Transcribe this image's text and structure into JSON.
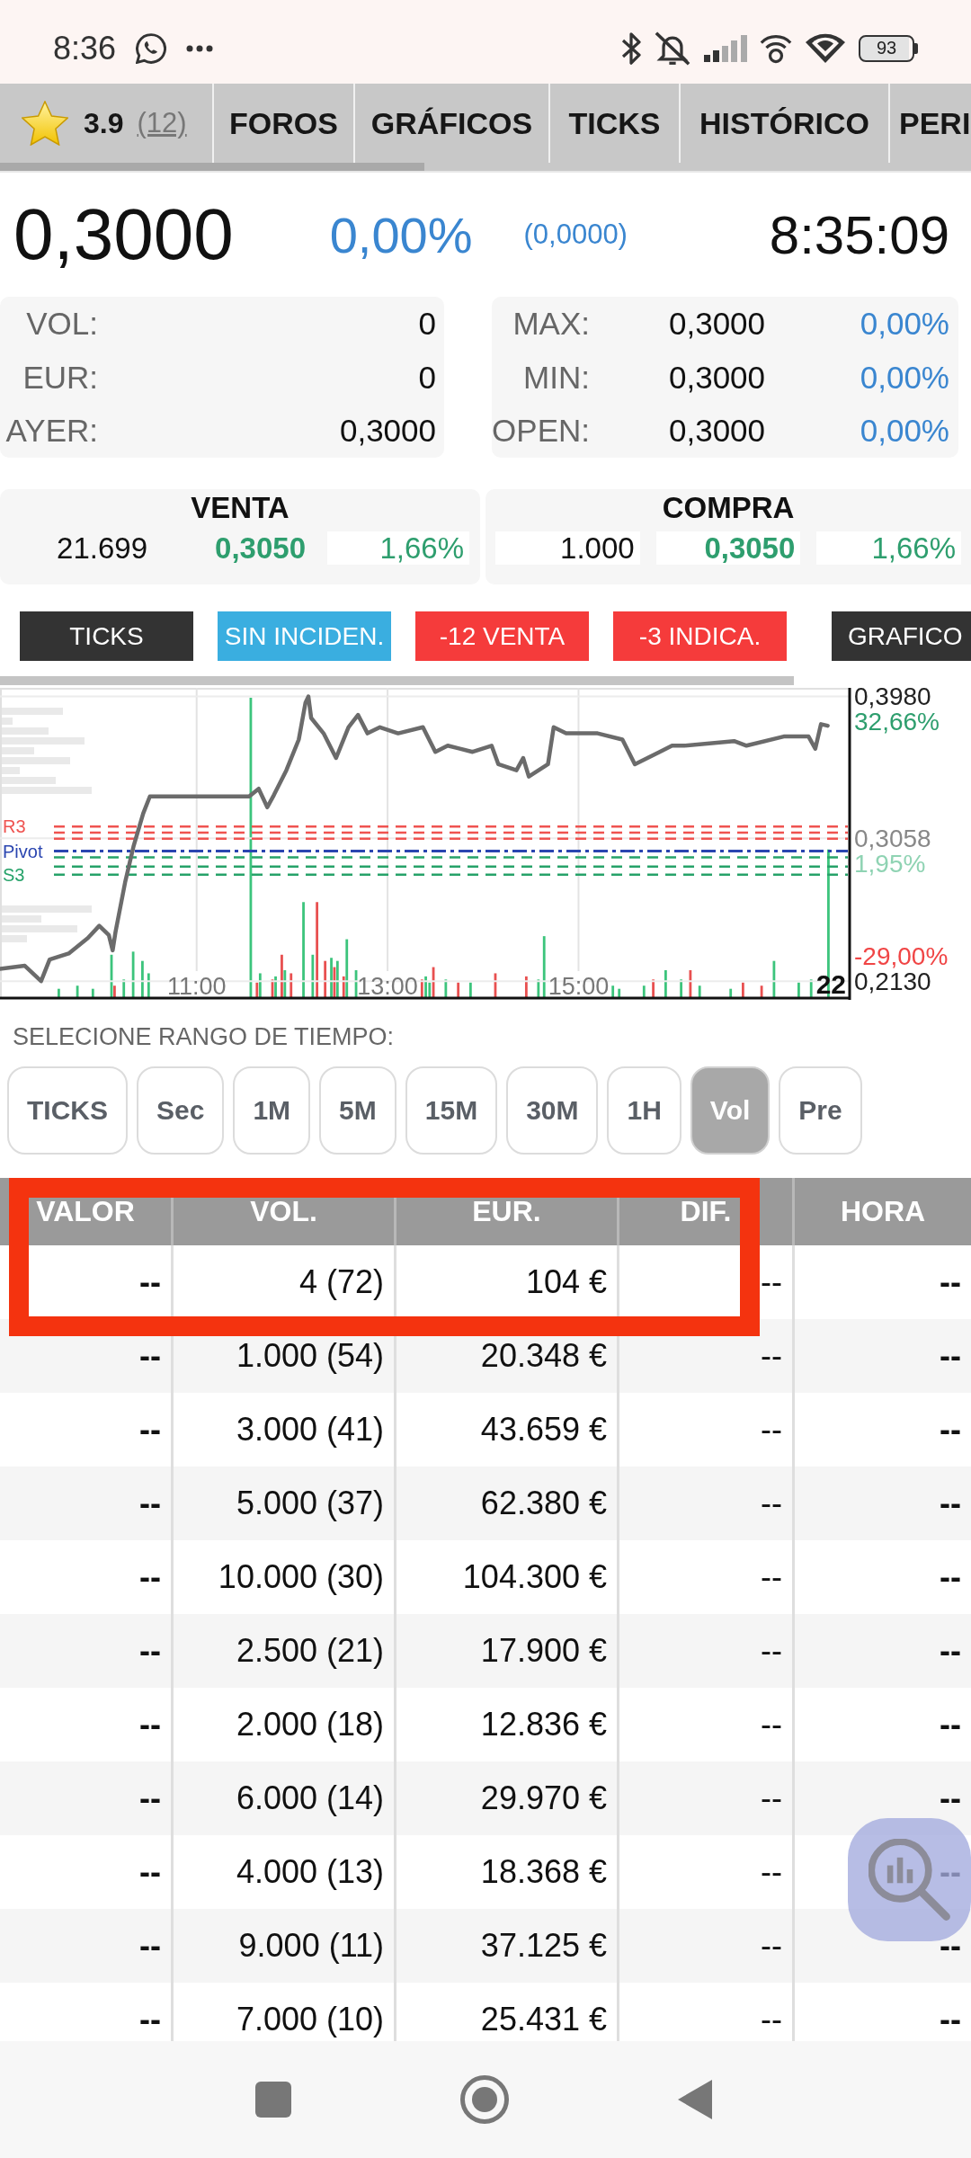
{
  "status_bar": {
    "time": "8:36",
    "battery": "93"
  },
  "tabs": {
    "rating": {
      "score": "3.9",
      "count": "(12)"
    },
    "items": [
      {
        "label": "FOROS",
        "selected": false
      },
      {
        "label": "GRÁFICOS",
        "selected": false
      },
      {
        "label": "TICKS",
        "selected": false
      },
      {
        "label": "HISTÓRICO",
        "selected": false
      },
      {
        "label": "PERI",
        "selected": false
      }
    ]
  },
  "quote": {
    "price": "0,3000",
    "change_percent": "0,00%",
    "change": "(0,0000)",
    "time": "8:35:09"
  },
  "stats": {
    "left": [
      {
        "label": "VOL:",
        "value": "0"
      },
      {
        "label": "EUR:",
        "value": "0"
      },
      {
        "label": "AYER:",
        "value": "0,3000"
      }
    ],
    "right": [
      {
        "label": "MAX:",
        "value": "0,3000",
        "change": "0,00%"
      },
      {
        "label": "MIN:",
        "value": "0,3000",
        "change": "0,00%"
      },
      {
        "label": "OPEN:",
        "value": "0,3000",
        "change": "0,00%"
      }
    ]
  },
  "order_book": [
    {
      "title": "VENTA",
      "cells": [
        {
          "kind": "quantity",
          "text": "21.699",
          "boxed": false
        },
        {
          "kind": "price",
          "text": "0,3050",
          "boxed": false
        },
        {
          "kind": "change",
          "text": "1,66%",
          "boxed": true
        }
      ]
    },
    {
      "title": "COMPRA",
      "cells": [
        {
          "kind": "quantity",
          "text": "1.000",
          "boxed": true
        },
        {
          "kind": "price",
          "text": "0,3050",
          "boxed": true
        },
        {
          "kind": "change",
          "text": "1,66%",
          "boxed": true
        }
      ]
    }
  ],
  "indicators": [
    {
      "label": "TICKS",
      "color": "#333333"
    },
    {
      "label": "SIN INCIDEN.",
      "color": "#3aaee0"
    },
    {
      "label": "-12 VENTA",
      "color": "#f53b3b"
    },
    {
      "label": "-3 INDICA.",
      "color": "#f53b3b"
    },
    {
      "label": "GRAFICO",
      "color": "#333333"
    }
  ],
  "chart": {
    "chart_data": {
      "type": "line",
      "x": [
        8.94,
        9.2,
        9.37,
        9.46,
        9.66,
        9.86,
        9.98,
        10.08,
        10.12,
        10.15,
        10.25,
        10.34,
        10.44,
        10.51,
        11.55,
        11.65,
        11.74,
        11.81,
        11.94,
        12.07,
        12.14,
        12.17,
        12.2,
        12.33,
        12.46,
        12.59,
        12.69,
        12.79,
        12.92,
        13.11,
        13.37,
        13.5,
        13.63,
        13.89,
        14.09,
        14.16,
        14.35,
        14.42,
        14.48,
        14.68,
        14.74,
        14.87,
        15.2,
        15.46,
        15.59,
        15.85,
        15.98,
        16.11,
        16.63,
        16.76,
        17.15,
        17.41,
        17.48,
        17.54,
        17.61
      ],
      "values": [
        0.221,
        0.223,
        0.213,
        0.227,
        0.231,
        0.241,
        0.249,
        0.243,
        0.233,
        0.245,
        0.277,
        0.301,
        0.322,
        0.333,
        0.333,
        0.338,
        0.326,
        0.334,
        0.35,
        0.37,
        0.394,
        0.398,
        0.384,
        0.374,
        0.358,
        0.378,
        0.386,
        0.374,
        0.378,
        0.374,
        0.378,
        0.362,
        0.366,
        0.362,
        0.366,
        0.354,
        0.35,
        0.358,
        0.346,
        0.354,
        0.378,
        0.374,
        0.374,
        0.37,
        0.354,
        0.362,
        0.366,
        0.366,
        0.369,
        0.366,
        0.372,
        0.372,
        0.364,
        0.38,
        0.379
      ],
      "xlim": [
        8.94,
        17.84
      ],
      "ylim": [
        0.202,
        0.403
      ],
      "xticks": [
        {
          "value": 11,
          "label": "11:00"
        },
        {
          "value": 13,
          "label": "13:00"
        },
        {
          "value": 15,
          "label": "15:00"
        }
      ],
      "yticks": [
        {
          "value": 0.398,
          "label": "0,3980"
        },
        {
          "value": 0.3058,
          "label": "0,3058"
        },
        {
          "value": 0.213,
          "label": "0,2130"
        }
      ],
      "grid": true,
      "ref_lines": [
        {
          "axis": "y",
          "value": 0.3135,
          "label": "R3",
          "color": "#ef5350"
        },
        {
          "axis": "y",
          "value": 0.3095,
          "color": "#ef5350"
        },
        {
          "axis": "y",
          "value": 0.3055,
          "color": "#ef5350"
        },
        {
          "axis": "y",
          "value": 0.2975,
          "label": "Pivot",
          "color": "#2a45b0"
        },
        {
          "axis": "y",
          "value": 0.2934,
          "color": "#26a269"
        },
        {
          "axis": "y",
          "value": 0.2874,
          "color": "#26a269"
        },
        {
          "axis": "y",
          "value": 0.2822,
          "label": "S3",
          "color": "#26a269"
        }
      ]
    },
    "tick_notes": [
      {
        "text": "32,66%",
        "color": "#2e9e6e"
      },
      {
        "text": "1,95%",
        "color": "#8fd3b3"
      },
      {
        "text": "-29,00%",
        "color": "#f04545"
      }
    ],
    "volume_label": "22"
  },
  "time_range": {
    "title": "SELECIONE RANGO DE TIEMPO:",
    "options": [
      {
        "label": "TICKS",
        "selected": false
      },
      {
        "label": "Sec",
        "selected": false
      },
      {
        "label": "1M",
        "selected": false
      },
      {
        "label": "5M",
        "selected": false
      },
      {
        "label": "15M",
        "selected": false
      },
      {
        "label": "30M",
        "selected": false
      },
      {
        "label": "1H",
        "selected": false
      },
      {
        "label": "Vol",
        "selected": true
      },
      {
        "label": "Pre",
        "selected": false
      }
    ]
  },
  "table": {
    "columns": [
      "VALOR",
      "VOL.",
      "EUR.",
      "DIF.",
      "HORA"
    ],
    "rows": [
      [
        "--",
        "4 (72)",
        "104 €",
        "--",
        "--"
      ],
      [
        "--",
        "1.000 (54)",
        "20.348 €",
        "--",
        "--"
      ],
      [
        "--",
        "3.000 (41)",
        "43.659 €",
        "--",
        "--"
      ],
      [
        "--",
        "5.000 (37)",
        "62.380 €",
        "--",
        "--"
      ],
      [
        "--",
        "10.000 (30)",
        "104.300 €",
        "--",
        "--"
      ],
      [
        "--",
        "2.500 (21)",
        "17.900 €",
        "--",
        "--"
      ],
      [
        "--",
        "2.000 (18)",
        "12.836 €",
        "--",
        "--"
      ],
      [
        "--",
        "6.000 (14)",
        "29.970 €",
        "--",
        "--"
      ],
      [
        "--",
        "4.000 (13)",
        "18.368 €",
        "--",
        "--"
      ],
      [
        "--",
        "9.000 (11)",
        "37.125 €",
        "--",
        "--"
      ],
      [
        "--",
        "7.000 (10)",
        "25.431 €",
        "--",
        "--"
      ]
    ],
    "highlight": {
      "kind": "rectangle"
    }
  }
}
